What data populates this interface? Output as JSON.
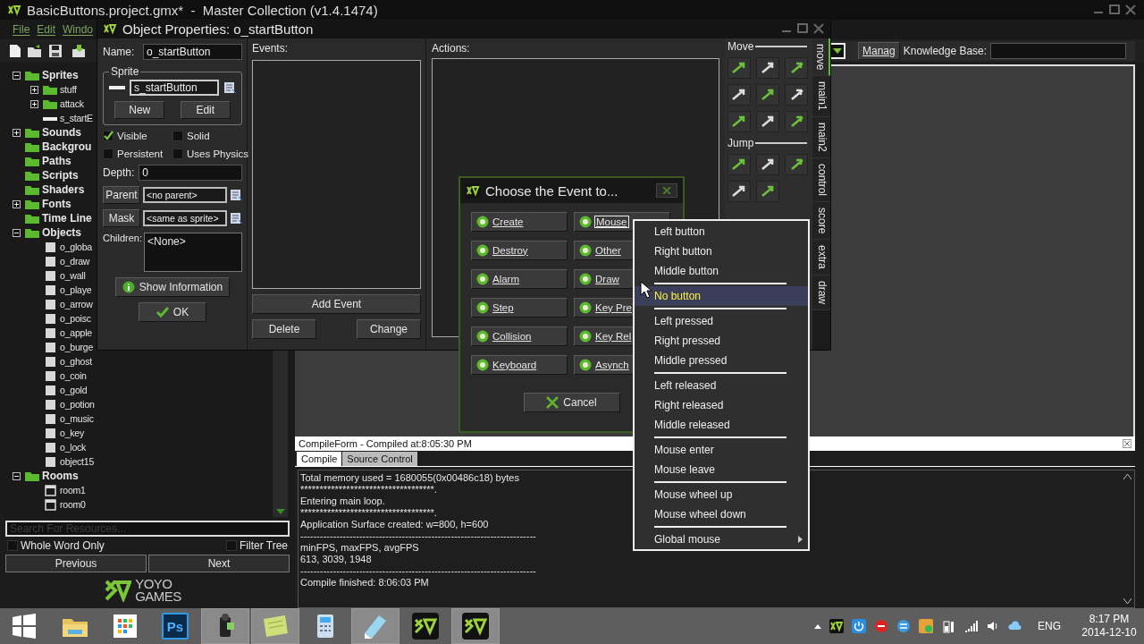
{
  "app": {
    "title": "BasicButtons.project.gmx*  -  Master Collection (v1.4.1474)",
    "menu": [
      "File",
      "Edit",
      "Windo"
    ]
  },
  "toolbar": {
    "manage_button": "Manag",
    "knowledge_label": "Knowledge Base:"
  },
  "tree": [
    {
      "label": "Sprites",
      "expanded": true,
      "kind": "folder",
      "children": [
        {
          "label": "stuff",
          "kind": "folder",
          "expanded": false
        },
        {
          "label": "attack",
          "kind": "folder",
          "expanded": false
        },
        {
          "label": "s_startE",
          "kind": "sprite"
        }
      ]
    },
    {
      "label": "Sounds",
      "kind": "folder",
      "expanded": false
    },
    {
      "label": "Backgrou",
      "kind": "folder"
    },
    {
      "label": "Paths",
      "kind": "folder"
    },
    {
      "label": "Scripts",
      "kind": "folder"
    },
    {
      "label": "Shaders",
      "kind": "folder"
    },
    {
      "label": "Fonts",
      "kind": "folder",
      "expanded": false
    },
    {
      "label": "Time Line",
      "kind": "folder"
    },
    {
      "label": "Objects",
      "kind": "folder",
      "expanded": true,
      "children": [
        {
          "label": "o_globa",
          "kind": "object"
        },
        {
          "label": "o_draw",
          "kind": "object"
        },
        {
          "label": "o_wall",
          "kind": "object"
        },
        {
          "label": "o_playe",
          "kind": "object"
        },
        {
          "label": "o_arrow",
          "kind": "object"
        },
        {
          "label": "o_poisc",
          "kind": "object"
        },
        {
          "label": "o_apple",
          "kind": "object"
        },
        {
          "label": "o_burge",
          "kind": "object"
        },
        {
          "label": "o_ghost",
          "kind": "object"
        },
        {
          "label": "o_coin",
          "kind": "object"
        },
        {
          "label": "o_gold",
          "kind": "object"
        },
        {
          "label": "o_potion",
          "kind": "object"
        },
        {
          "label": "o_music",
          "kind": "object"
        },
        {
          "label": "o_key",
          "kind": "object"
        },
        {
          "label": "o_lock",
          "kind": "object"
        },
        {
          "label": "object15",
          "kind": "object"
        }
      ]
    },
    {
      "label": "Rooms",
      "kind": "folder",
      "expanded": true,
      "children": [
        {
          "label": "room1",
          "kind": "room"
        },
        {
          "label": "room0",
          "kind": "room"
        }
      ]
    }
  ],
  "search": {
    "placeholder": "Search For Resources...",
    "options": [
      {
        "label": "Whole Word Only",
        "checked": false
      },
      {
        "label": "Filter Tree",
        "checked": false
      }
    ],
    "buttons": [
      "Previous",
      "Next"
    ]
  },
  "logo": [
    "YOYO",
    "GAMES"
  ],
  "object_properties": {
    "title": "Object Properties: o_startButton",
    "name_label": "Name:",
    "name": "o_startButton",
    "sprite_group": "Sprite",
    "sprite": "s_startButton",
    "sprite_buttons": [
      "New",
      "Edit"
    ],
    "options": [
      {
        "label": "Visible",
        "checked": true
      },
      {
        "label": "Solid",
        "checked": false
      },
      {
        "label": "Persistent",
        "checked": false
      },
      {
        "label": "Uses Physics",
        "checked": false
      }
    ],
    "depth_label": "Depth:",
    "depth": "0",
    "parent_button": "Parent",
    "parent": "<no parent>",
    "mask_button": "Mask",
    "mask": "<same as sprite>",
    "children_label": "Children:",
    "children": "<None>",
    "info_button": "Show Information",
    "ok_button": "OK",
    "events_label": "Events:",
    "add_event": "Add Event",
    "event_buttons": [
      "Delete",
      "Change"
    ],
    "actions_label": "Actions:",
    "palette": [
      {
        "title": "Move"
      },
      {
        "title": "Jump"
      }
    ],
    "tabs": [
      {
        "label": "move",
        "selected": true
      },
      {
        "label": "main1",
        "selected": false
      },
      {
        "label": "main2",
        "selected": false
      },
      {
        "label": "control",
        "selected": false
      },
      {
        "label": "score",
        "selected": false
      },
      {
        "label": "extra",
        "selected": false
      },
      {
        "label": "draw",
        "selected": false
      }
    ]
  },
  "event_dialog": {
    "title": "Choose the Event to...",
    "buttons": [
      {
        "label": "Create",
        "focused": false
      },
      {
        "label": "Mouse",
        "focused": true
      },
      {
        "label": "Destroy",
        "focused": false
      },
      {
        "label": "Other",
        "focused": false
      },
      {
        "label": "Alarm",
        "focused": false
      },
      {
        "label": "Draw",
        "focused": false
      },
      {
        "label": "Step",
        "focused": false
      },
      {
        "label": "Key Pre",
        "focused": false
      },
      {
        "label": "Collision",
        "focused": false
      },
      {
        "label": "Key Rel",
        "focused": false
      },
      {
        "label": "Keyboard",
        "focused": false
      },
      {
        "label": "Asynch",
        "focused": false
      }
    ],
    "cancel": "Cancel"
  },
  "mouse_menu": [
    {
      "kind": "item",
      "label": "Left button",
      "selected": false
    },
    {
      "kind": "item",
      "label": "Right button",
      "selected": false
    },
    {
      "kind": "item",
      "label": "Middle button",
      "selected": false
    },
    {
      "kind": "separator"
    },
    {
      "kind": "item",
      "label": "No button",
      "selected": true
    },
    {
      "kind": "separator"
    },
    {
      "kind": "item",
      "label": "Left pressed",
      "selected": false
    },
    {
      "kind": "item",
      "label": "Right pressed",
      "selected": false
    },
    {
      "kind": "item",
      "label": "Middle pressed",
      "selected": false
    },
    {
      "kind": "separator"
    },
    {
      "kind": "item",
      "label": "Left released",
      "selected": false
    },
    {
      "kind": "item",
      "label": "Right released",
      "selected": false
    },
    {
      "kind": "item",
      "label": "Middle released",
      "selected": false
    },
    {
      "kind": "separator"
    },
    {
      "kind": "item",
      "label": "Mouse enter",
      "selected": false
    },
    {
      "kind": "item",
      "label": "Mouse leave",
      "selected": false
    },
    {
      "kind": "separator"
    },
    {
      "kind": "item",
      "label": "Mouse wheel up",
      "selected": false
    },
    {
      "kind": "item",
      "label": "Mouse wheel down",
      "selected": false
    },
    {
      "kind": "separator"
    },
    {
      "kind": "submenu",
      "label": "Global mouse",
      "selected": false
    }
  ],
  "compile_form": {
    "title": "CompileForm - Compiled at:8:05:30 PM",
    "tabs": [
      {
        "label": "Compile",
        "selected": true
      },
      {
        "label": "Source Control",
        "selected": false
      }
    ],
    "log": [
      "Total memory used = 1680055(0x00486c18) bytes",
      "***********************************.",
      "Entering main loop.",
      "***********************************.",
      "Application Surface created: w=800, h=600",
      "------------------------------------------------------------------------",
      "minFPS, maxFPS, avgFPS",
      "613, 3039, 1948",
      "------------------------------------------------------------------------",
      "Compile finished: 8:06:03 PM"
    ]
  },
  "taskbar": {
    "items": [
      {
        "kind": "start",
        "active": false
      },
      {
        "kind": "folder",
        "active": false
      },
      {
        "kind": "tiles",
        "active": false
      },
      {
        "kind": "app",
        "label": "Ps",
        "active": false
      },
      {
        "kind": "camera",
        "active": true
      },
      {
        "kind": "note",
        "active": true
      },
      {
        "kind": "calculator",
        "active": false
      },
      {
        "kind": "notepad",
        "active": true
      },
      {
        "kind": "gm",
        "active": false
      },
      {
        "kind": "gm",
        "active": true
      }
    ],
    "language": "ENG",
    "time": "8:17 PM",
    "date": "2014-12-10"
  }
}
